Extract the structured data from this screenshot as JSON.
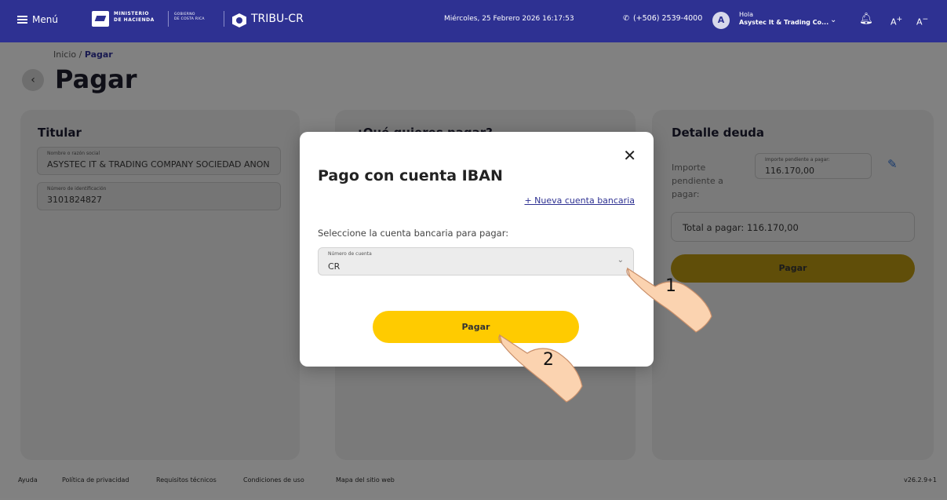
{
  "topbar": {
    "menu_label": "Menú",
    "ministerio_line1": "MINISTERIO",
    "ministerio_line2": "DE HACIENDA",
    "gobierno_line1": "GOBIERNO",
    "gobierno_line2": "DE COSTA RICA",
    "brand": "TRIBU-CR",
    "datetime": "Miércoles, 25 Febrero 2026 16:17:53",
    "phone": "(+506) 2539-4000",
    "avatar_initial": "A",
    "greeting": "Hola",
    "user_name": "Asystec It & Trading Co...",
    "font_increase": "A",
    "font_decrease": "A",
    "colors": {
      "bar": "#2e3192",
      "accent_yellow": "#ffcb00"
    }
  },
  "header": {
    "breadcrumb_home": "Inicio",
    "breadcrumb_sep": " / ",
    "breadcrumb_current": "Pagar",
    "title": "Pagar"
  },
  "titular": {
    "title": "Titular",
    "name_label": "Nombre o razón social",
    "name_value": "ASYSTEC IT & TRADING COMPANY SOCIEDAD ANON",
    "id_label": "Número de identificación",
    "id_value": "3101824827"
  },
  "middle": {
    "title": "¿Qué quieres pagar?"
  },
  "detalle": {
    "title": "Detalle deuda",
    "importe_label": "Importe pendiente a pagar:",
    "importe_field_label": "Importe pendiente a pagar:",
    "importe_value": "116.170,00",
    "total_text": "Total a pagar: 116.170,00",
    "pay_button": "Pagar"
  },
  "modal": {
    "title": "Pago con cuenta IBAN",
    "close": "✕",
    "new_account_link": "+ Nueva cuenta bancaria",
    "instruction": "Seleccione la cuenta bancaria para pagar:",
    "account_label": "Número de cuenta",
    "account_value": "CR",
    "pay_button": "Pagar"
  },
  "annotations": {
    "step1": "1",
    "step2": "2"
  },
  "footer": {
    "links": [
      "Ayuda",
      "Política de privacidad",
      "Requisitos técnicos",
      "Condiciones de uso",
      "Mapa del sitio web"
    ],
    "version": "v26.2.9+1"
  }
}
